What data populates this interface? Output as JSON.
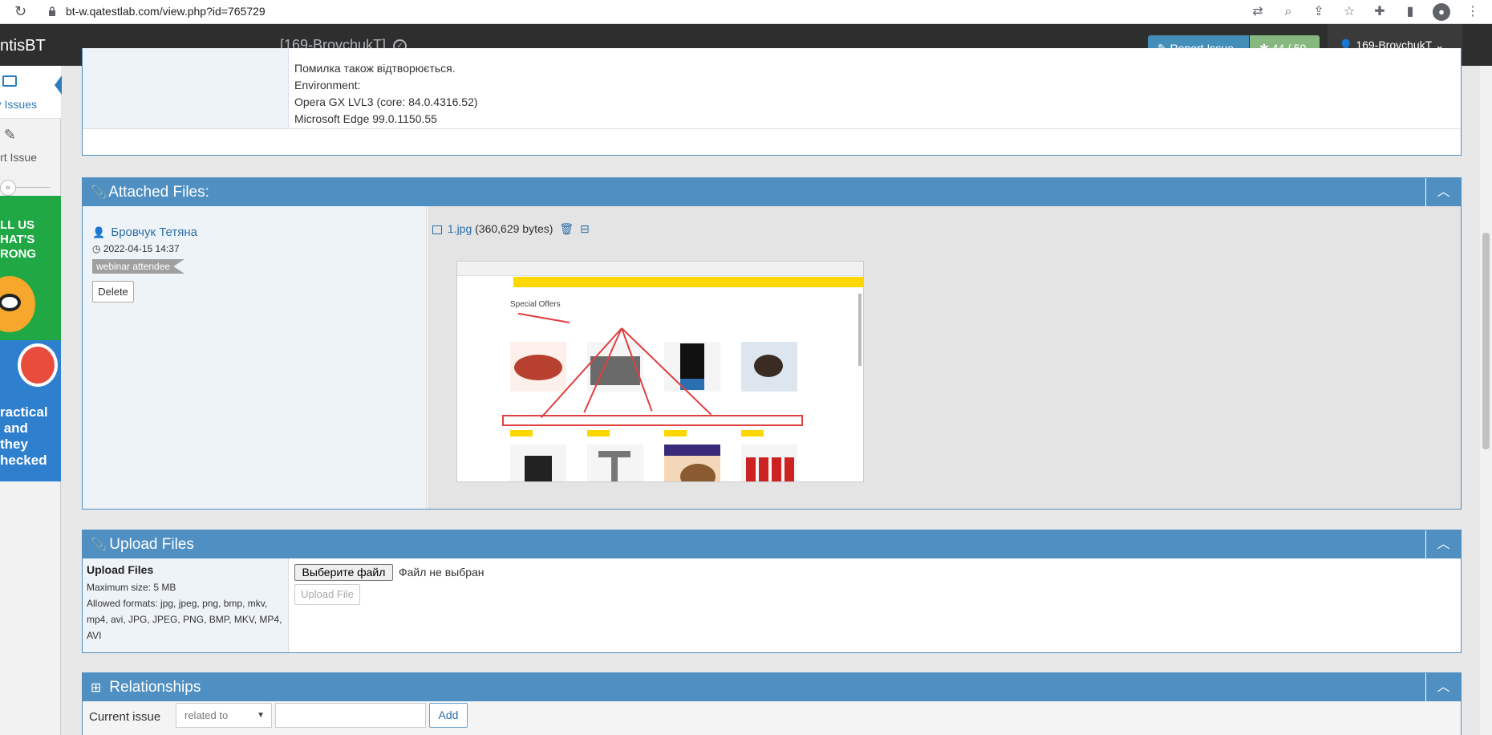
{
  "browser": {
    "url": "bt-w.qatestlab.com/view.php?id=765729"
  },
  "navbar": {
    "brand": "ntisBT",
    "project": "[169-BrovchukT]",
    "report_issue": "Report Issue",
    "counter": "44 / 50",
    "user": "169-BrovchukT"
  },
  "sidebar": {
    "view_issues": "v Issues",
    "report_issue": "ort Issue",
    "banner1_text": "LL US\nHAT'S\nRONG",
    "banner2_text": "ractical\n and\nthey\nhecked"
  },
  "description_tail": {
    "lines": [
      "Помилка також відтворюється.",
      "Environment:",
      "Opera GX LVL3 (core: 84.0.4316.52)",
      "Microsoft Edge 99.0.1150.55"
    ]
  },
  "attached_files": {
    "title": "Attached Files:",
    "author": "Бровчук Тетяна",
    "date": "2022-04-15 14:37",
    "badge": "webinar attendee",
    "delete_label": "Delete",
    "file_name": "1.jpg",
    "file_size": "(360,629 bytes)",
    "preview_title": "Special Offers"
  },
  "upload": {
    "title": "Upload Files",
    "label": "Upload Files",
    "max_size": "Maximum size: 5 MB",
    "formats": "Allowed formats: jpg, jpeg, png, bmp, mkv, mp4, avi, JPG, JPEG, PNG, BMP, MKV, MP4, AVI",
    "choose_button": "Выберите файл",
    "no_file": "Файл не выбран",
    "upload_button": "Upload File"
  },
  "relationships": {
    "title": "Relationships",
    "label": "Current issue",
    "select_value": "related to",
    "add_label": "Add"
  }
}
